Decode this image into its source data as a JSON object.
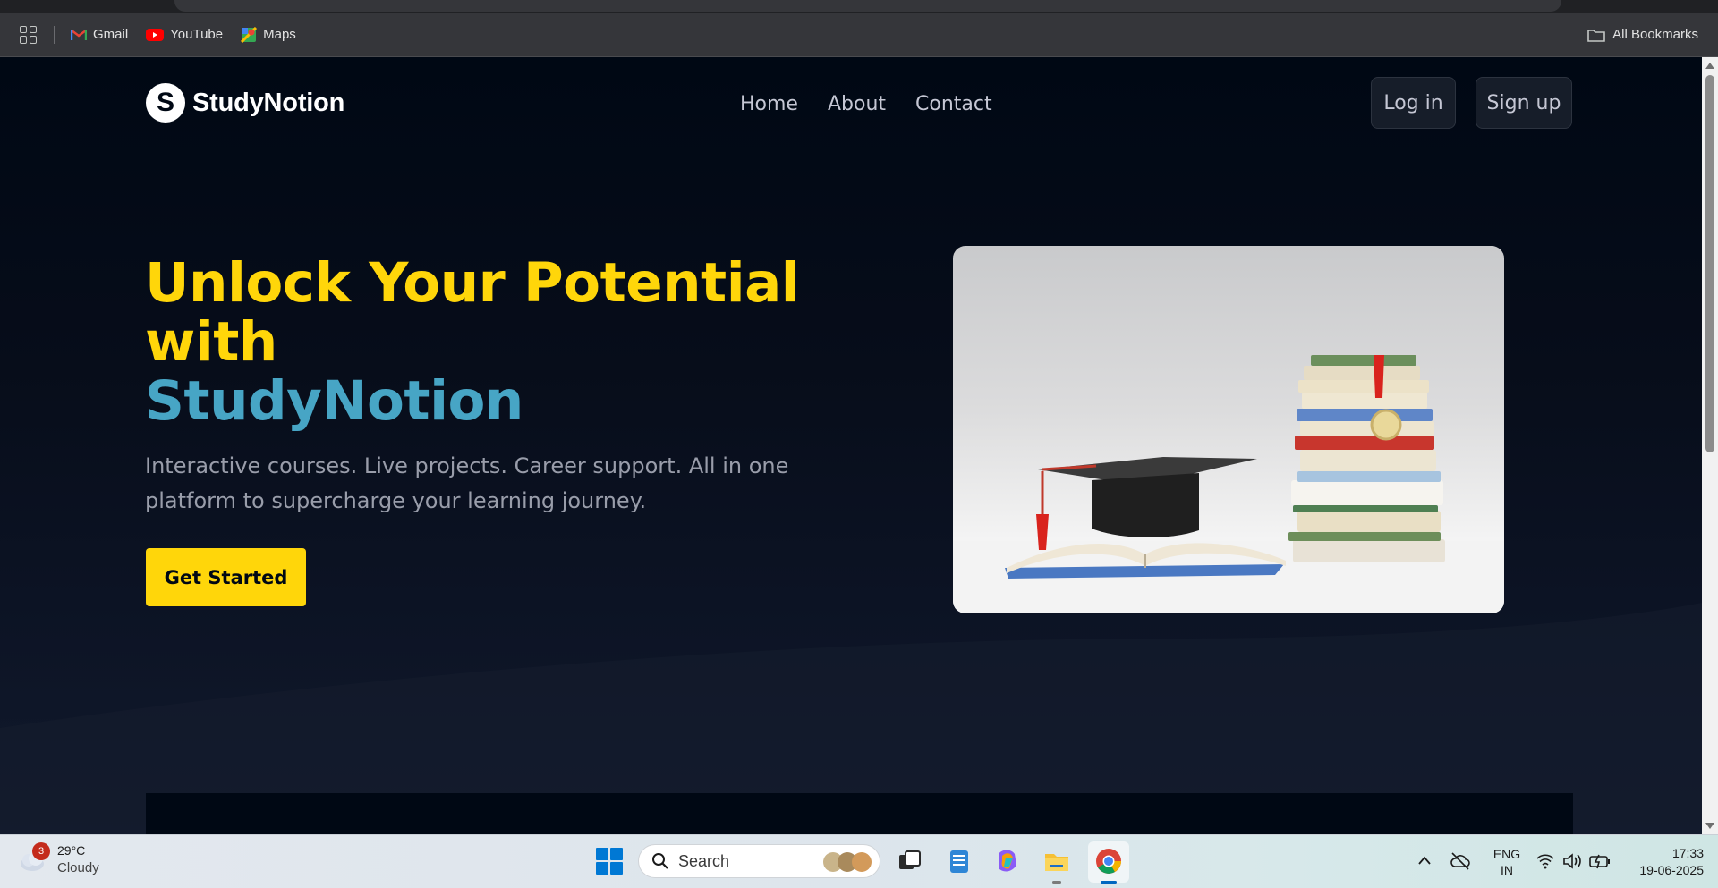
{
  "bookmarks": {
    "items": [
      {
        "label": "Gmail",
        "icon": "gmail-icon"
      },
      {
        "label": "YouTube",
        "icon": "youtube-icon"
      },
      {
        "label": "Maps",
        "icon": "maps-icon"
      }
    ],
    "all_bookmarks": "All Bookmarks"
  },
  "site": {
    "logo_letter": "S",
    "logo_text": "StudyNotion",
    "nav": [
      "Home",
      "About",
      "Contact"
    ],
    "login": "Log in",
    "signup": "Sign up"
  },
  "hero": {
    "title_line1": "Unlock Your Potential",
    "title_line2": "with",
    "title_brand": "StudyNotion",
    "subtitle": "Interactive courses. Live projects. Career support. All in one platform to supercharge your learning journey.",
    "cta": "Get Started"
  },
  "taskbar": {
    "weather_temp": "29°C",
    "weather_condition": "Cloudy",
    "weather_badge": "3",
    "search_placeholder": "Search",
    "lang_line1": "ENG",
    "lang_line2": "IN",
    "time": "17:33",
    "date": "19-06-2025"
  },
  "colors": {
    "accent_yellow": "#ffd60a",
    "accent_blue": "#47a5c5",
    "page_bg": "#000814"
  }
}
